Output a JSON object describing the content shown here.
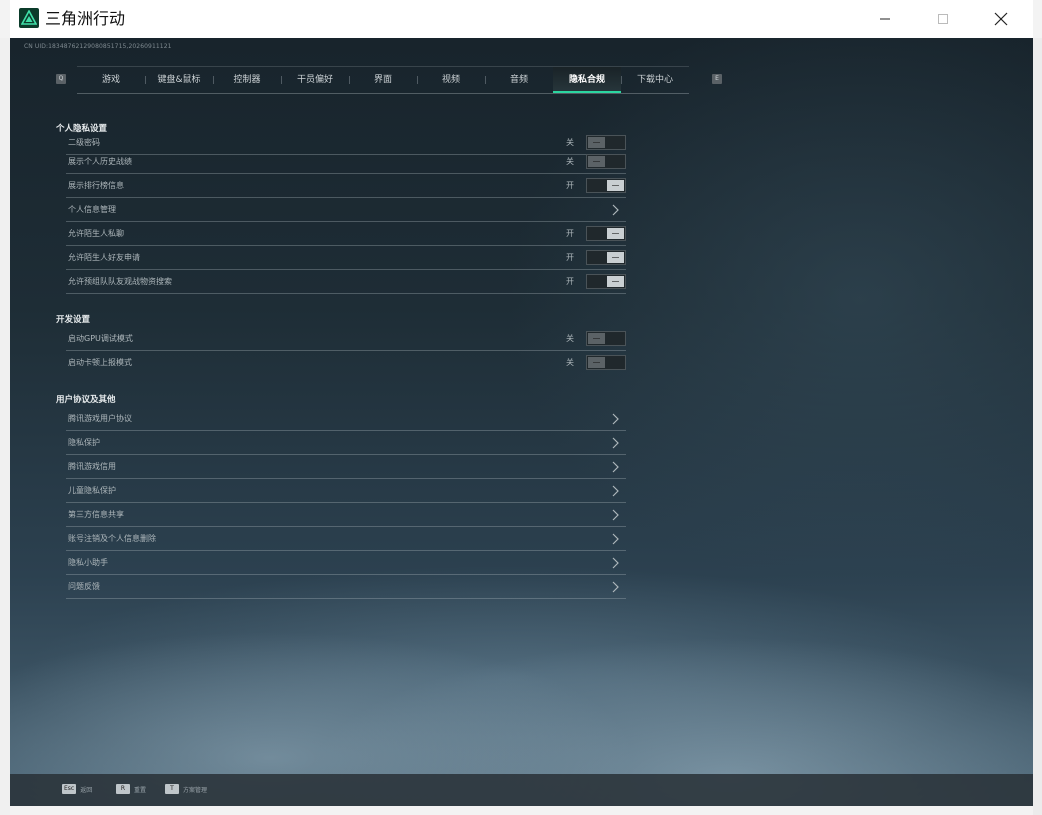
{
  "window": {
    "title": "三角洲行动"
  },
  "game": {
    "uid": "CN UID:18348762129080851715,20260911121"
  },
  "tabs": [
    {
      "label": "游戏",
      "active": false
    },
    {
      "label": "键盘&鼠标",
      "active": false
    },
    {
      "label": "控制器",
      "active": false
    },
    {
      "label": "干员偏好",
      "active": false
    },
    {
      "label": "界面",
      "active": false
    },
    {
      "label": "视频",
      "active": false
    },
    {
      "label": "音频",
      "active": false
    },
    {
      "label": "隐私合规",
      "active": true
    },
    {
      "label": "下载中心",
      "active": false
    }
  ],
  "tab_nav": {
    "left": "Q",
    "right": "E"
  },
  "sections": {
    "personal": {
      "title": "个人隐私设置",
      "rows": [
        {
          "label": "二级密码",
          "state": "关",
          "on": false
        },
        {
          "label": "展示个人历史战绩",
          "state": "关",
          "on": false
        },
        {
          "label": "展示排行榜信息",
          "state": "开",
          "on": true
        },
        {
          "label": "个人信息管理"
        },
        {
          "label": "允许陌生人私聊",
          "state": "开",
          "on": true
        },
        {
          "label": "允许陌生人好友申请",
          "state": "开",
          "on": true
        },
        {
          "label": "允许预组队队友观战物资搜索",
          "state": "开",
          "on": true
        }
      ]
    },
    "developer": {
      "title": "开发设置",
      "rows": [
        {
          "label": "启动GPU调试模式",
          "state": "关",
          "on": false
        },
        {
          "label": "启动卡顿上报模式",
          "state": "关",
          "on": false
        }
      ]
    },
    "agreements": {
      "title": "用户协议及其他",
      "rows": [
        {
          "label": "腾讯游戏用户协议"
        },
        {
          "label": "隐私保护"
        },
        {
          "label": "腾讯游戏信用"
        },
        {
          "label": "儿童隐私保护"
        },
        {
          "label": "第三方信息共享"
        },
        {
          "label": "账号注销及个人信息删除"
        },
        {
          "label": "隐私小助手"
        },
        {
          "label": "问题反馈"
        }
      ]
    }
  },
  "footer": [
    {
      "key": "Esc",
      "label": "返回"
    },
    {
      "key": "R",
      "label": "重置"
    },
    {
      "key": "T",
      "label": "方案管理"
    }
  ],
  "colors": {
    "accent": "#2bd6a0",
    "logo_bg": "#0b3b2a"
  }
}
